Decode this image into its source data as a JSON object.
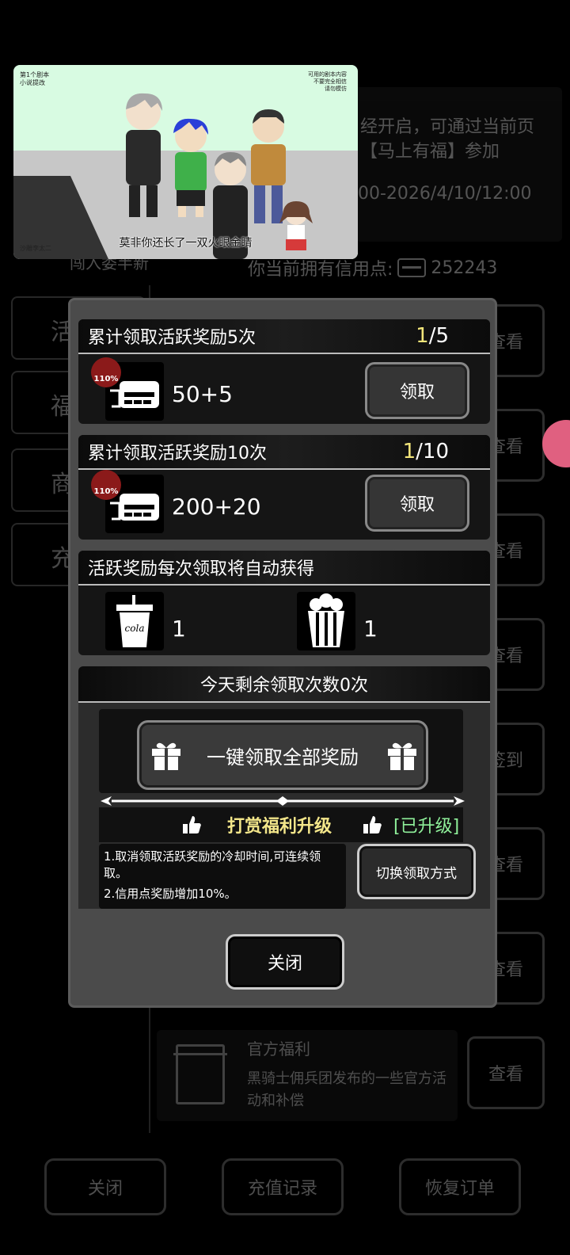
{
  "background": {
    "notice_line1": "经开启，可通过当前页",
    "notice_line2": "【马上有福】参加",
    "time_range": "00-2026/4/10/12:00",
    "tab_under_video": "闯入委半新",
    "credit_label": "你当前拥有信用点:",
    "credit_value": "252243",
    "sidebar_tabs": [
      "活",
      "福",
      "商",
      "充"
    ],
    "view_buttons": [
      "查看",
      "查看",
      "查看",
      "查看",
      "签到",
      "查看",
      "查看",
      "查看"
    ],
    "official_title": "官方福利",
    "official_desc": "黑骑士佣兵团发布的一些官方活动和补偿",
    "bottom_buttons": [
      "关闭",
      "充值记录",
      "恢复订单"
    ]
  },
  "video": {
    "top_left_text": "第1个剧本\n小说提改",
    "top_right_text": "可用的剧本内容\n不要完全相信\n请勿模仿",
    "credit_text": "沙雕李太二",
    "subtitle": "莫非你还长了一双火眼金睛"
  },
  "dialog": {
    "reward5": {
      "title": "累计领取活跃奖励5次",
      "progress_current": "1",
      "progress_total": "/5",
      "badge": "110%",
      "value": "50+5",
      "button": "领取"
    },
    "reward10": {
      "title": "累计领取活跃奖励10次",
      "progress_current": "1",
      "progress_total": "/10",
      "badge": "110%",
      "value": "200+20",
      "button": "领取"
    },
    "auto": {
      "title": "活跃奖励每次领取将自动获得",
      "cola_label": "cola",
      "cola_count": "1",
      "popcorn_count": "1"
    },
    "remaining": "今天剩余领取次数0次",
    "bulk_button": "一键领取全部奖励",
    "upgrade": {
      "title": "打赏福利升级",
      "status": "[已升级]"
    },
    "desc_line1": "1.取消领取活跃奖励的冷却时间,可连续领取。",
    "desc_line2": "2.信用点奖励增加10%。",
    "switch_button": "切换领取方式",
    "close_button": "关闭"
  },
  "colors": {
    "progress_highlight": "#f2e57a",
    "upgrade_title": "#f3e68a",
    "upgrade_status": "#8ff09a",
    "badge": "#8b1a1a"
  }
}
